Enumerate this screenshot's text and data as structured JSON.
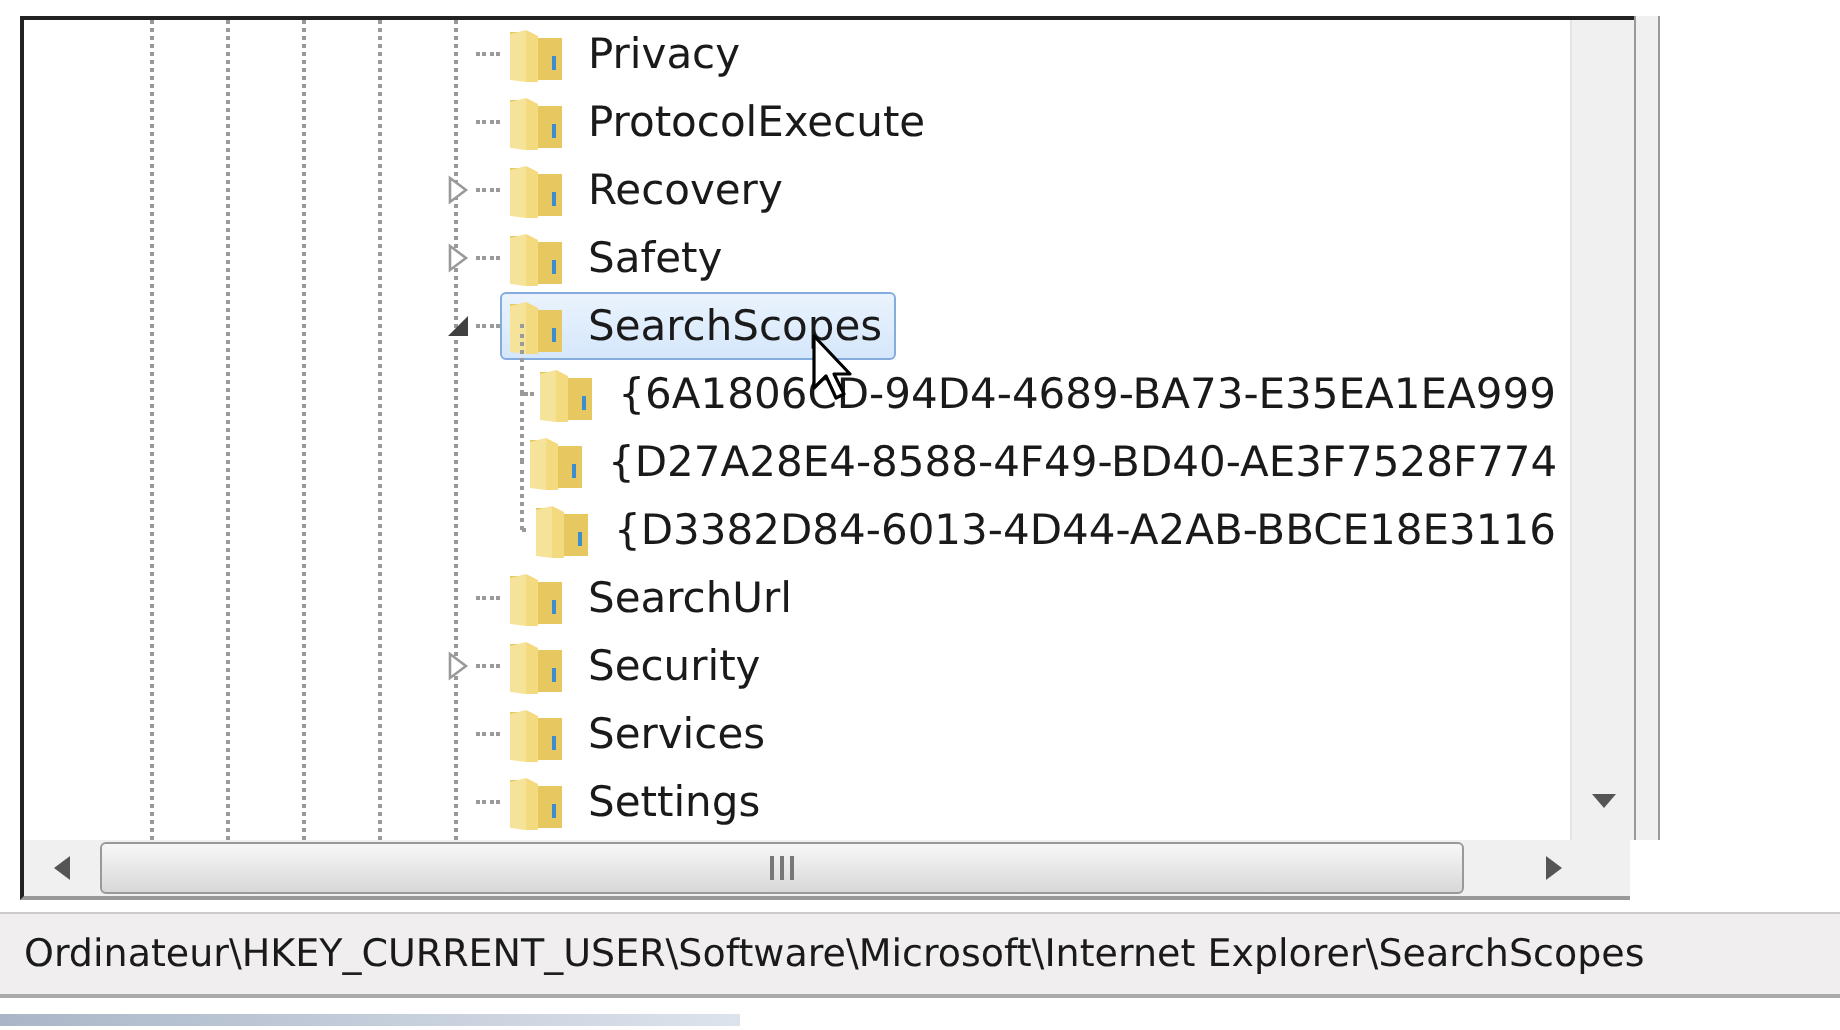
{
  "tree": {
    "items": [
      {
        "label": "Privacy",
        "selected": false
      },
      {
        "label": "ProtocolExecute",
        "selected": false
      },
      {
        "label": "Recovery",
        "expanded": false,
        "selected": false
      },
      {
        "label": "Safety",
        "expanded": false,
        "selected": false
      },
      {
        "label": "SearchScopes",
        "expanded": true,
        "selected": true,
        "children": [
          {
            "label": "{6A1806CD-94D4-4689-BA73-E35EA1EA999",
            "selected": false
          },
          {
            "label": "{D27A28E4-8588-4F49-BD40-AE3F7528F774",
            "selected": false
          },
          {
            "label": "{D3382D84-6013-4D44-A2AB-BBCE18E3116",
            "selected": false
          }
        ]
      },
      {
        "label": "SearchUrl",
        "selected": false
      },
      {
        "label": "Security",
        "expanded": false,
        "selected": false
      },
      {
        "label": "Services",
        "selected": false
      },
      {
        "label": "Settings",
        "selected": false
      }
    ]
  },
  "status_bar": {
    "path": "Ordinateur\\HKEY_CURRENT_USER\\Software\\Microsoft\\Internet Explorer\\SearchScopes"
  }
}
